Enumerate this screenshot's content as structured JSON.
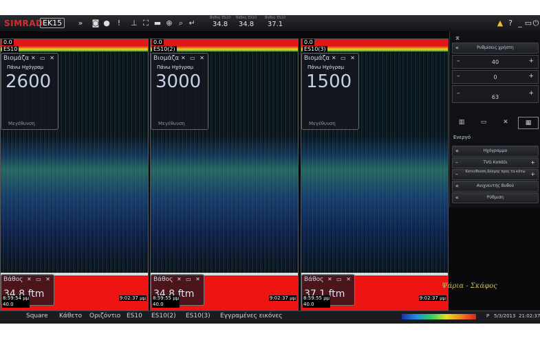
{
  "app": {
    "logo": "SIMRAD",
    "model": "EK15"
  },
  "topbar": {
    "depth_label": "Βάθος ES10",
    "depth_boxes": [
      {
        "label": "Βάθος ES10",
        "value": "34.8"
      },
      {
        "label": "Βάθος ES10",
        "value": "34.8"
      },
      {
        "label": "Βάθος ES10",
        "value": "37.1"
      }
    ],
    "right_icons": [
      "warning",
      "?",
      "minimize",
      "restore",
      "power"
    ]
  },
  "panels": [
    {
      "name": "ES10",
      "top_range": "0.0",
      "biomass_title": "Βιομάζα",
      "biomass_sub": "Πάνω Ηχόγραμ",
      "biomass_value": "2600",
      "magnify": "Μεγέθυνση",
      "depth_title": "Βάθος",
      "depth_value": "34.8 ftm",
      "time_left": "8:59:54 μμ",
      "range_bottom": "40.0",
      "time_right": "9:02:37 μμ"
    },
    {
      "name": "ES10(2)",
      "top_range": "0.0",
      "biomass_title": "Βιομάζα",
      "biomass_sub": "Πάνω Ηχόγραμ",
      "biomass_value": "3000",
      "magnify": "Μεγέθυνση",
      "depth_title": "Βάθος",
      "depth_value": "34.8 ftm",
      "time_left": "8:59:55 μμ",
      "range_bottom": "40.0",
      "time_right": "9:02:37 μμ"
    },
    {
      "name": "ES10(3)",
      "top_range": "0.0",
      "biomass_title": "Βιομάζα",
      "biomass_sub": "Πάνω Ηχόγραμ",
      "biomass_value": "1500",
      "magnify": "Μεγέθυνση",
      "depth_title": "Βάθος",
      "depth_value": "37.1 ftm",
      "time_left": "8:59:55 μμ",
      "range_bottom": "40.0",
      "time_right": "9:02:37 μμ"
    }
  ],
  "side": {
    "title": "Ρυθμίσεις χρήστη",
    "stepper1": "40",
    "stepper2": "0",
    "stepper3": "63",
    "section": "Ενεργό",
    "items": [
      {
        "label": "Ηχόγραμμα"
      },
      {
        "label": "TVG Κοπάδι"
      },
      {
        "label": "Κατεύθυνση Δέσμης προς τα κάτω"
      },
      {
        "label": "Ανιχνευτής Βυθού"
      },
      {
        "label": "Ρύθμιση"
      }
    ]
  },
  "statusbar": {
    "tabs": [
      "Square",
      "Κάθετο",
      "Οριζόντιο",
      "ES10",
      "ES10(2)",
      "ES10(3)",
      "Εγγραμένες εικόνες"
    ],
    "p_label": "P",
    "date": "5/3/2013",
    "time": "21:02:37"
  },
  "handwriting": "Ψάρια - Σκάφος"
}
